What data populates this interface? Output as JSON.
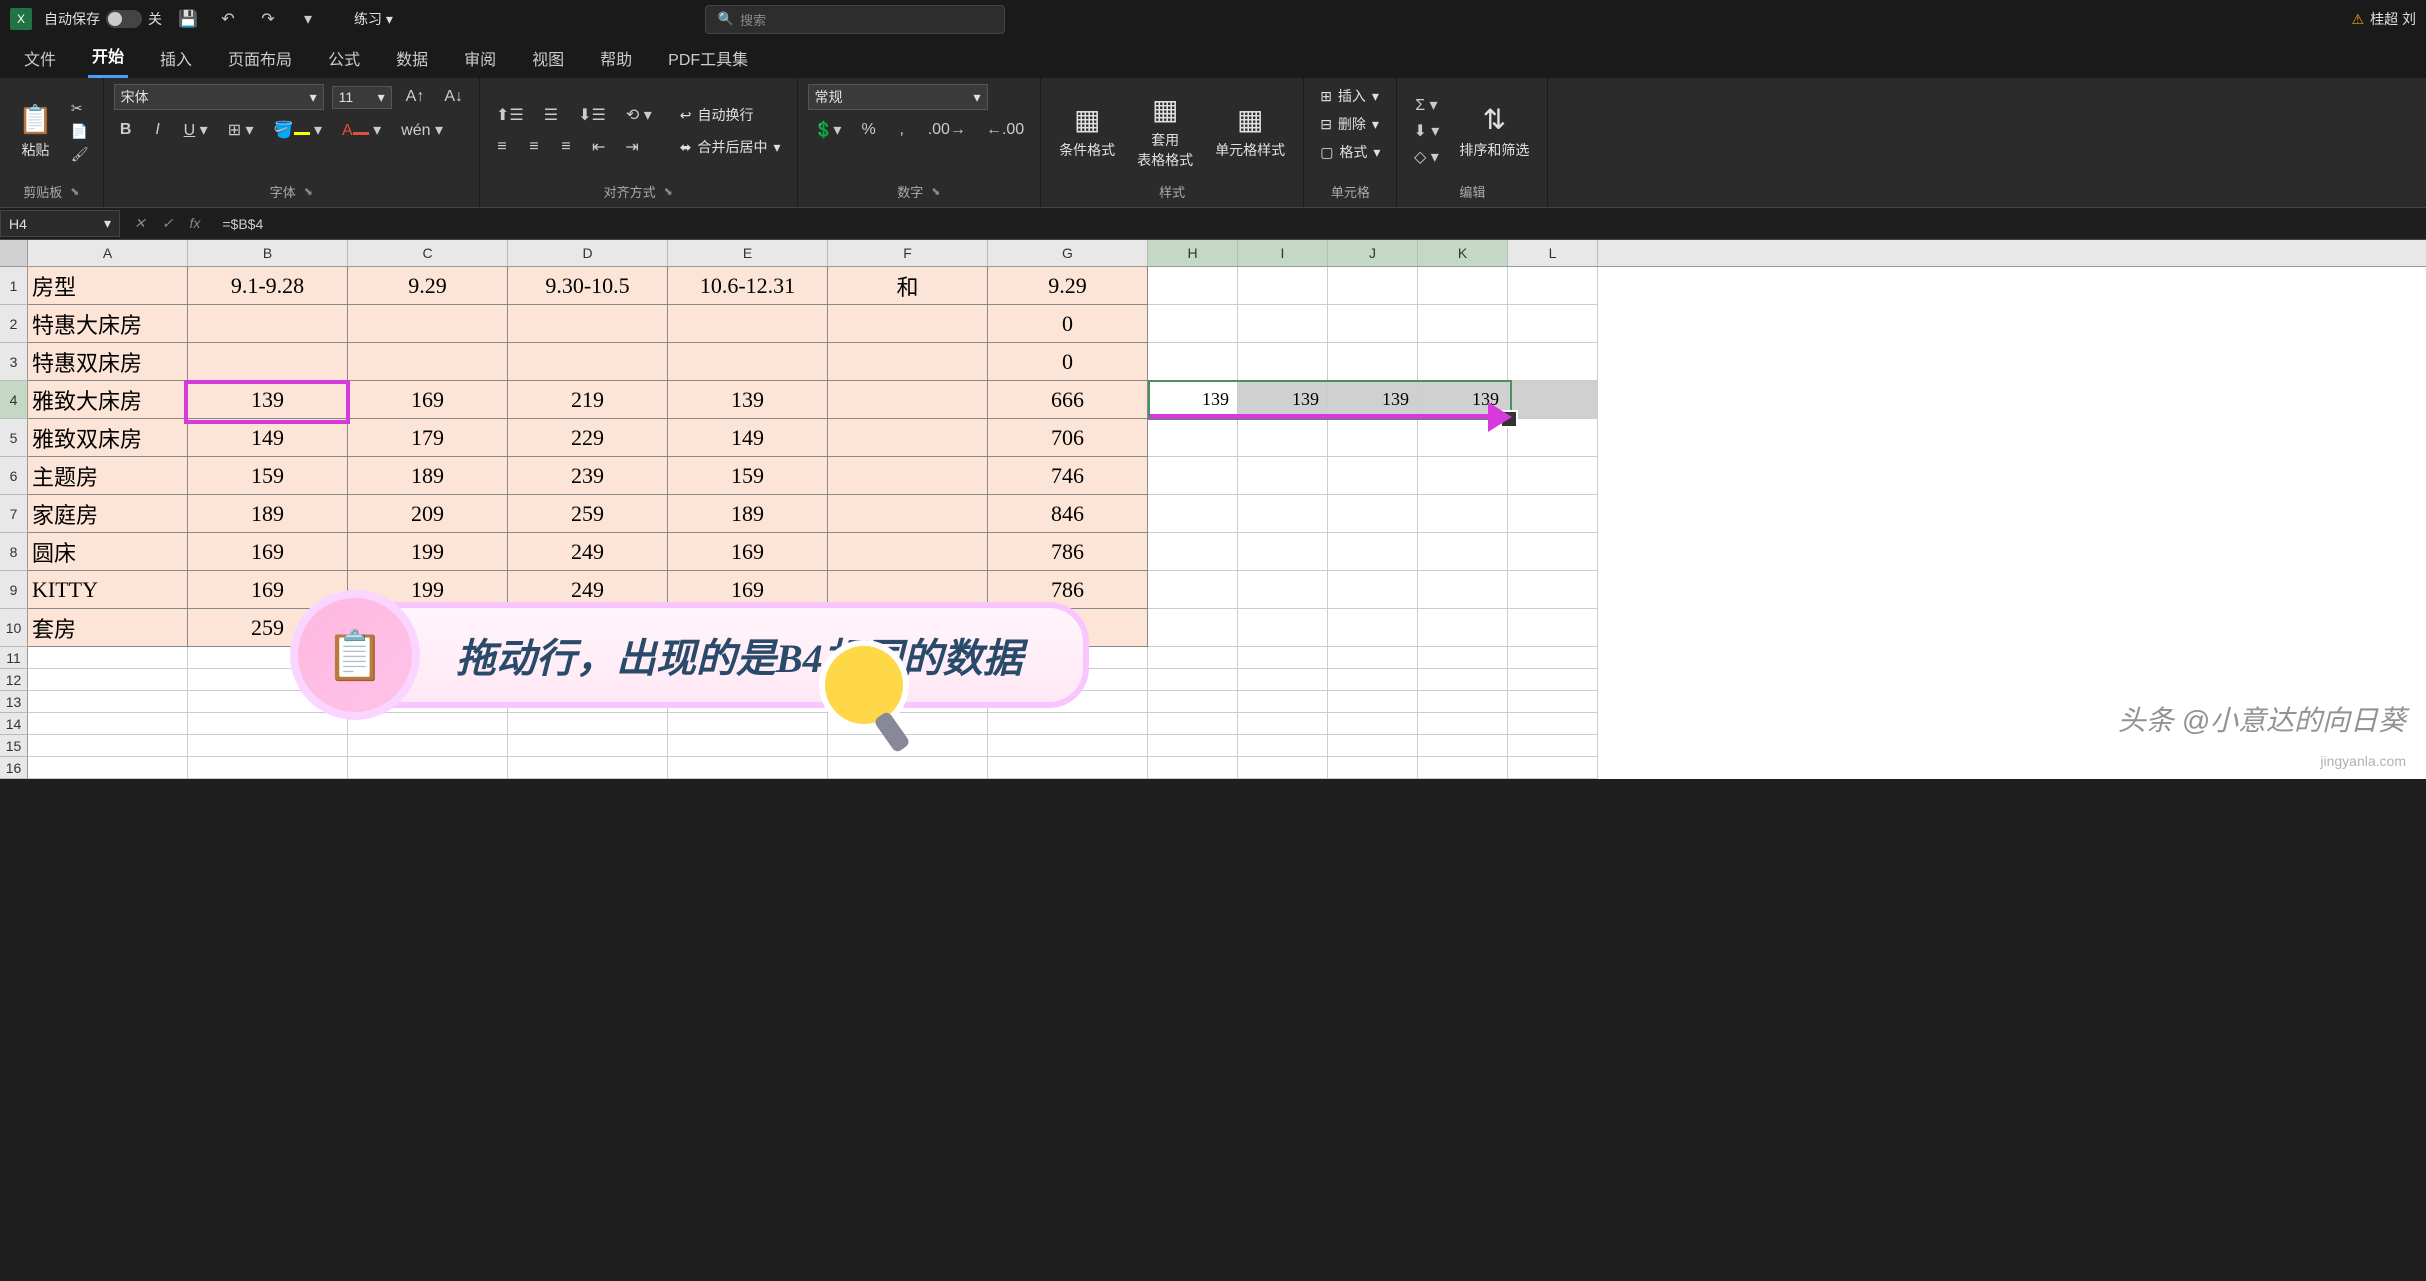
{
  "titlebar": {
    "autosave_label": "自动保存",
    "autosave_state": "关",
    "doc_name": "练习",
    "search_placeholder": "搜索",
    "user_name": "桂超 刘"
  },
  "tabs": {
    "file": "文件",
    "home": "开始",
    "insert": "插入",
    "layout": "页面布局",
    "formulas": "公式",
    "data": "数据",
    "review": "审阅",
    "view": "视图",
    "help": "帮助",
    "pdf": "PDF工具集"
  },
  "ribbon": {
    "clipboard": {
      "paste": "粘贴",
      "group": "剪贴板"
    },
    "font": {
      "name": "宋体",
      "size": "11",
      "ruby": "wén",
      "group": "字体"
    },
    "align": {
      "wrap": "自动换行",
      "merge": "合并后居中",
      "group": "对齐方式"
    },
    "number": {
      "format": "常规",
      "group": "数字"
    },
    "styles": {
      "cond": "条件格式",
      "table": "套用\n表格格式",
      "cell": "单元格样式",
      "group": "样式"
    },
    "cells": {
      "insert": "插入",
      "delete": "删除",
      "format": "格式",
      "group": "单元格"
    },
    "editing": {
      "sort": "排序和筛选",
      "group": "编辑"
    }
  },
  "formula_bar": {
    "cell_ref": "H4",
    "formula": "=$B$4"
  },
  "columns": [
    "A",
    "B",
    "C",
    "D",
    "E",
    "F",
    "G",
    "H",
    "I",
    "J",
    "K",
    "L"
  ],
  "rows": [
    {
      "n": 1,
      "cells": [
        "房型",
        "9.1-9.28",
        "9.29",
        "9.30-10.5",
        "10.6-12.31",
        "和",
        "9.29",
        "",
        "",
        "",
        "",
        ""
      ]
    },
    {
      "n": 2,
      "cells": [
        "特惠大床房",
        "",
        "",
        "",
        "",
        "",
        "0",
        "",
        "",
        "",
        "",
        ""
      ]
    },
    {
      "n": 3,
      "cells": [
        "特惠双床房",
        "",
        "",
        "",
        "",
        "",
        "0",
        "",
        "",
        "",
        "",
        ""
      ]
    },
    {
      "n": 4,
      "cells": [
        "雅致大床房",
        "139",
        "169",
        "219",
        "139",
        "",
        "666",
        "139",
        "139",
        "139",
        "139",
        ""
      ]
    },
    {
      "n": 5,
      "cells": [
        "雅致双床房",
        "149",
        "179",
        "229",
        "149",
        "",
        "706",
        "",
        "",
        "",
        "",
        ""
      ]
    },
    {
      "n": 6,
      "cells": [
        "主题房",
        "159",
        "189",
        "239",
        "159",
        "",
        "746",
        "",
        "",
        "",
        "",
        ""
      ]
    },
    {
      "n": 7,
      "cells": [
        "家庭房",
        "189",
        "209",
        "259",
        "189",
        "",
        "846",
        "",
        "",
        "",
        "",
        ""
      ]
    },
    {
      "n": 8,
      "cells": [
        "圆床",
        "169",
        "199",
        "249",
        "169",
        "",
        "786",
        "",
        "",
        "",
        "",
        ""
      ]
    },
    {
      "n": 9,
      "cells": [
        "KITTY",
        "169",
        "199",
        "249",
        "169",
        "",
        "786",
        "",
        "",
        "",
        "",
        ""
      ]
    },
    {
      "n": 10,
      "cells": [
        "套房",
        "259",
        "",
        "",
        "",
        "",
        "",
        "",
        "",
        "",
        "",
        ""
      ]
    }
  ],
  "annotation": {
    "text": "拖动行，出现的是B4相同的数据"
  },
  "watermark": {
    "main": "头条 @小意达的向日葵",
    "sub": "jingyanla.com"
  }
}
